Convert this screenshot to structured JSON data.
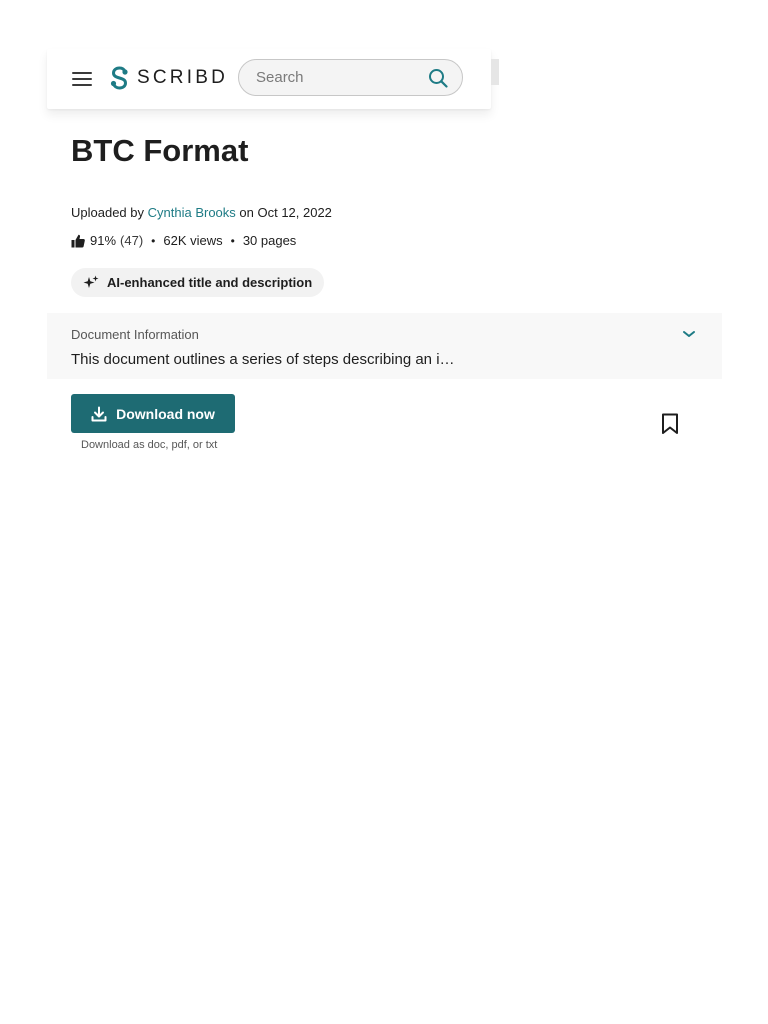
{
  "header": {
    "brand": "SCRIBD",
    "search_placeholder": "Search"
  },
  "document": {
    "title": "BTC Format",
    "uploaded_prefix": "Uploaded by",
    "author": "Cynthia Brooks",
    "uploaded_date": "on Oct 12, 2022",
    "rating_percent": "91%",
    "rating_count": "(47)",
    "views": "62K views",
    "pages": "30 pages",
    "ai_badge": "AI-enhanced title and description"
  },
  "doc_info": {
    "label": "Document Information",
    "description": "This document outlines a series of steps describing an i…"
  },
  "actions": {
    "download_label": "Download now",
    "download_formats": "Download as doc, pdf, or txt"
  },
  "colors": {
    "brand_teal": "#1e7b85",
    "download_button": "#1e6b73"
  },
  "icons": {
    "menu": "hamburger-icon",
    "logo": "scribd-logo-icon",
    "search": "search-icon",
    "rating": "thumbs-up-icon",
    "ai": "sparkle-icon",
    "expand": "chevron-down-icon",
    "download": "download-icon",
    "save": "bookmark-icon"
  }
}
